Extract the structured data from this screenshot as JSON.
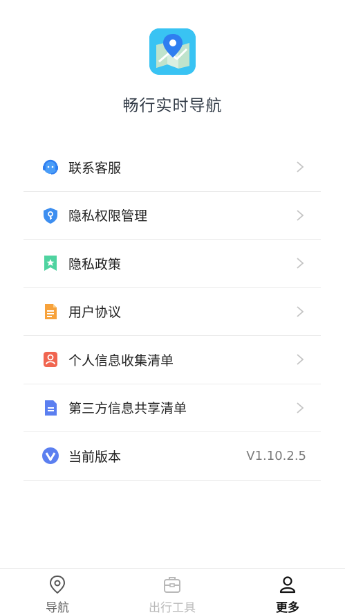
{
  "app": {
    "name": "畅行实时导航",
    "icon": "map-pin-app-icon",
    "brand_color": "#39c3f3"
  },
  "menu": {
    "items": [
      {
        "label": "联系客服",
        "icon": "customer-service-headset-icon",
        "icon_color": "#4a9df8"
      },
      {
        "label": "隐私权限管理",
        "icon": "shield-key-icon",
        "icon_color": "#3d8ef0"
      },
      {
        "label": "隐私政策",
        "icon": "bookmark-star-icon",
        "icon_color": "#4fd3a0"
      },
      {
        "label": "用户协议",
        "icon": "document-icon",
        "icon_color": "#f7a23b"
      },
      {
        "label": "个人信息收集清单",
        "icon": "person-badge-icon",
        "icon_color": "#f06550"
      },
      {
        "label": "第三方信息共享清单",
        "icon": "list-document-icon",
        "icon_color": "#5b7ff0"
      }
    ],
    "version": {
      "label": "当前版本",
      "value": "V1.10.2.5",
      "icon": "v-logo-icon",
      "icon_color": "#5b7ff0"
    }
  },
  "tabbar": {
    "tabs": [
      {
        "label": "导航",
        "icon": "navigation-pin-icon",
        "active": false,
        "color": "#666666"
      },
      {
        "label": "出行工具",
        "icon": "toolbox-icon",
        "active": false,
        "color": "#b8b8b8"
      },
      {
        "label": "更多",
        "icon": "user-icon",
        "active": true,
        "color": "#111111"
      }
    ]
  }
}
